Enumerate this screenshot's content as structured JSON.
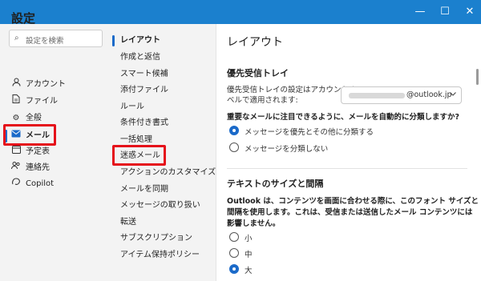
{
  "settings": {
    "title": "設定",
    "search_placeholder": "設定を検索",
    "nav": [
      {
        "label": "アカウント",
        "icon": "person-icon"
      },
      {
        "label": "ファイル",
        "icon": "file-icon"
      },
      {
        "label": "全般",
        "icon": "gear-icon"
      },
      {
        "label": "メール",
        "icon": "mail-icon",
        "active": true
      },
      {
        "label": "予定表",
        "icon": "calendar-icon"
      },
      {
        "label": "連絡先",
        "icon": "people-icon"
      },
      {
        "label": "Copilot",
        "icon": "copilot-icon"
      }
    ]
  },
  "mail_nav": [
    {
      "label": "レイアウト",
      "active": true
    },
    {
      "label": "作成と返信"
    },
    {
      "label": "スマート候補"
    },
    {
      "label": "添付ファイル"
    },
    {
      "label": "ルール"
    },
    {
      "label": "条件付き書式"
    },
    {
      "label": "一括処理"
    },
    {
      "label": "迷惑メール",
      "highlighted": true
    },
    {
      "label": "アクションのカスタマイズ"
    },
    {
      "label": "メールを同期"
    },
    {
      "label": "メッセージの取り扱い"
    },
    {
      "label": "転送"
    },
    {
      "label": "サブスクリプション"
    },
    {
      "label": "アイテム保持ポリシー"
    }
  ],
  "content": {
    "title": "レイアウト",
    "focused_inbox": {
      "heading": "優先受信トレイ",
      "description_line1": "優先受信トレイの設定はアカウント レ",
      "description_line2": "ベルで適用されます:",
      "account_value": "@outlook.jp",
      "question": "重要なメールに注目できるように、メールを自動的に分類しますか?",
      "options": [
        {
          "label": "メッセージを優先とその他に分類する",
          "selected": true
        },
        {
          "label": "メッセージを分類しない",
          "selected": false
        }
      ]
    },
    "text_size": {
      "heading": "テキストのサイズと間隔",
      "desc_line1": "Outlook は、コンテンツを画面に合わせる際に、このフォント サイズと",
      "desc_line2": "間隔を使用します。これは、受信または送信したメール コンテンツには",
      "desc_line3": "影響しません。",
      "options": [
        {
          "label": "小",
          "selected": false
        },
        {
          "label": "中",
          "selected": false
        },
        {
          "label": "大",
          "selected": true
        }
      ]
    }
  },
  "window_controls": {
    "minimize": "—",
    "maximize": "☐",
    "close": "✕"
  },
  "colors": {
    "titlebar": "#1b80ce",
    "accent": "#1b6ac9",
    "highlight": "#e5101a"
  }
}
